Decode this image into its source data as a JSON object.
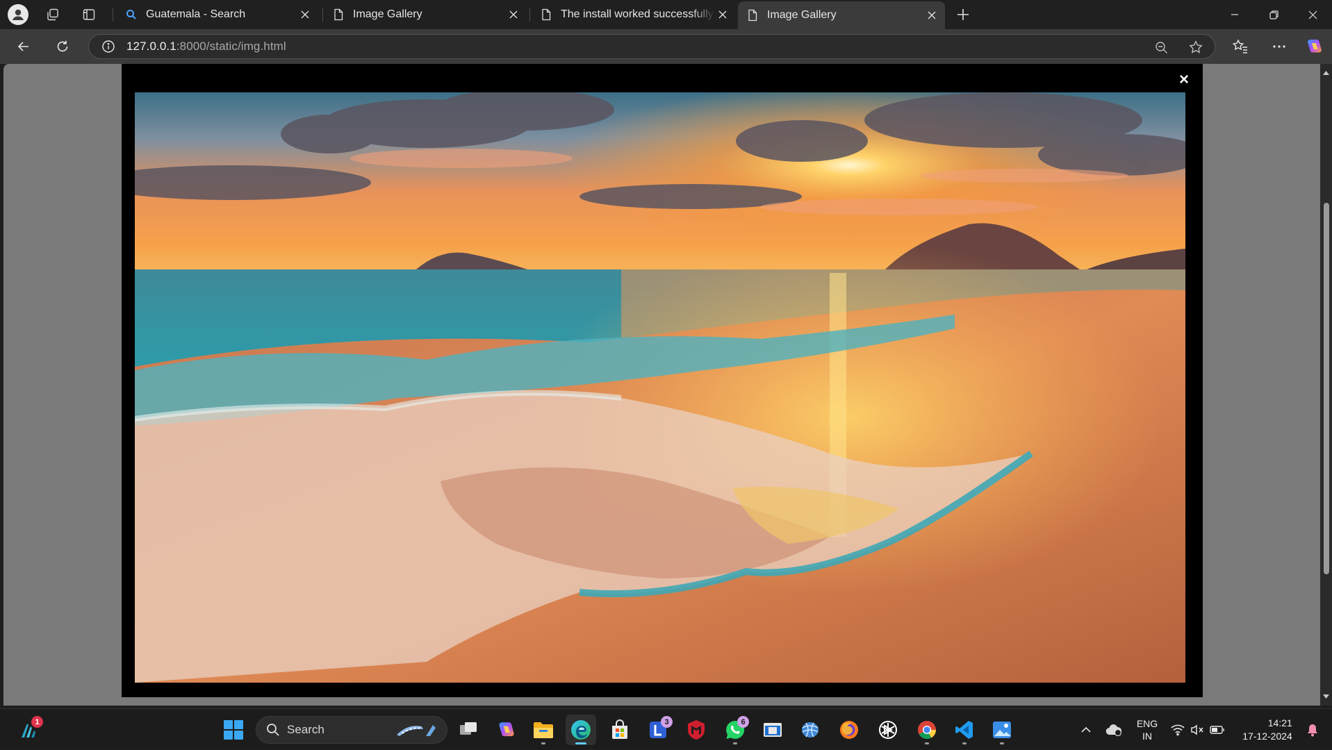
{
  "browser": {
    "tabs": [
      {
        "title": "Guatemala - Search",
        "icon": "search-icon",
        "active": false
      },
      {
        "title": "Image Gallery",
        "icon": "page-icon",
        "active": false
      },
      {
        "title": "The install worked successfully! Co",
        "icon": "page-icon",
        "active": false
      },
      {
        "title": "Image Gallery",
        "icon": "page-icon",
        "active": true
      }
    ],
    "address": {
      "host": "127.0.0.1",
      "path": ":8000/static/img.html"
    }
  },
  "modal": {
    "close_glyph": "×",
    "image_subject": "sunset over ocean beach with waves"
  },
  "taskbar": {
    "search_label": "Search",
    "badges": {
      "widgets": "1",
      "teams": "3",
      "whatsapp": "6"
    },
    "language": {
      "line1": "ENG",
      "line2": "IN"
    },
    "clock": {
      "time": "14:21",
      "date": "17-12-2024"
    }
  },
  "colors": {
    "accent": "#60cdff",
    "tab_active": "#3b3b3b",
    "toolbar": "#3b3b3b",
    "page_backdrop": "#7a7a7a",
    "modal_bg": "#000000"
  }
}
